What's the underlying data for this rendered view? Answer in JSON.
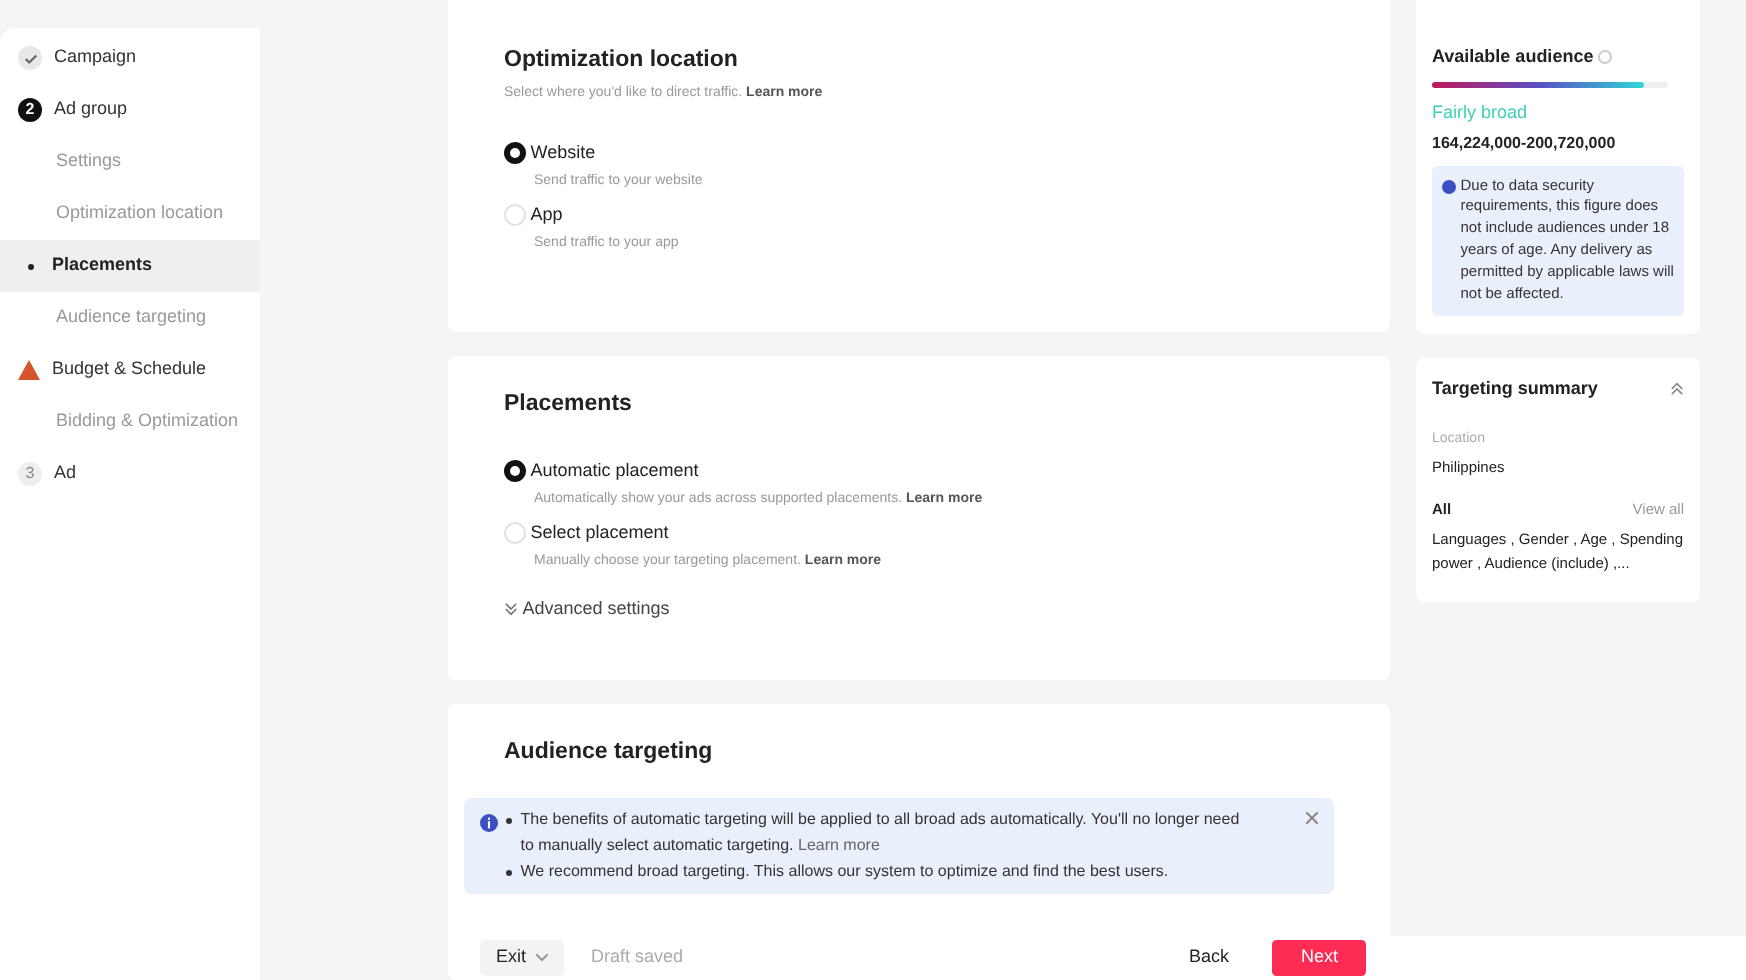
{
  "sidebar": {
    "items": [
      {
        "label": "Campaign",
        "kind": "done",
        "selected": false
      },
      {
        "label": "Ad group",
        "kind": "step",
        "number": "2",
        "selected": false
      },
      {
        "label": "Settings",
        "kind": "sub",
        "selected": false
      },
      {
        "label": "Optimization location",
        "kind": "sub",
        "selected": false
      },
      {
        "label": "Placements",
        "kind": "sub",
        "selected": true
      },
      {
        "label": "Audience targeting",
        "kind": "sub",
        "selected": false
      },
      {
        "label": "Budget & Schedule",
        "kind": "warning",
        "selected": false
      },
      {
        "label": "Bidding & Optimization",
        "kind": "sub",
        "selected": false
      },
      {
        "label": "Ad",
        "kind": "pending",
        "number": "3",
        "selected": false
      }
    ]
  },
  "optimization_location": {
    "title": "Optimization location",
    "description": "Select where you'd like to direct traffic.",
    "link": "Learn more",
    "options": [
      {
        "label": "Website",
        "hint": "Send traffic to your website",
        "selected": true
      },
      {
        "label": "App",
        "hint": "Send traffic to your app",
        "selected": false
      }
    ]
  },
  "placements": {
    "title": "Placements",
    "options": [
      {
        "label": "Automatic placement",
        "hint": "Automatically show your ads across supported placements.",
        "link": "Learn more",
        "selected": true
      },
      {
        "label": "Select placement",
        "hint": "Manually choose your targeting placement.",
        "link": "Learn more",
        "selected": false
      }
    ],
    "advanced": "Advanced settings"
  },
  "audience_targeting": {
    "title": "Audience targeting",
    "notice": [
      {
        "text": "The benefits of automatic targeting will be applied to all broad ads automatically. You'll no longer need to manually select automatic targeting.",
        "link": "Learn more"
      },
      {
        "text": "We recommend broad targeting. This allows our system to optimize and find the best users."
      }
    ]
  },
  "available_audience": {
    "title": "Available audience",
    "level": 0.9,
    "rating": "Fairly broad",
    "range": "164,224,000-200,720,000",
    "note": "Due to data security requirements, this figure does not include audiences under 18 years of age. Any delivery as permitted by applicable laws will not be affected."
  },
  "targeting_summary": {
    "title": "Targeting summary",
    "expanded": true,
    "location_label": "Location",
    "location": "Philippines",
    "all_label": "All",
    "view_all": "View all",
    "details": "Languages , Gender , Age , Spending power , Audience (include) ,..."
  },
  "footer": {
    "exit": "Exit",
    "status": "Draft saved",
    "back": "Back",
    "next": "Next"
  }
}
